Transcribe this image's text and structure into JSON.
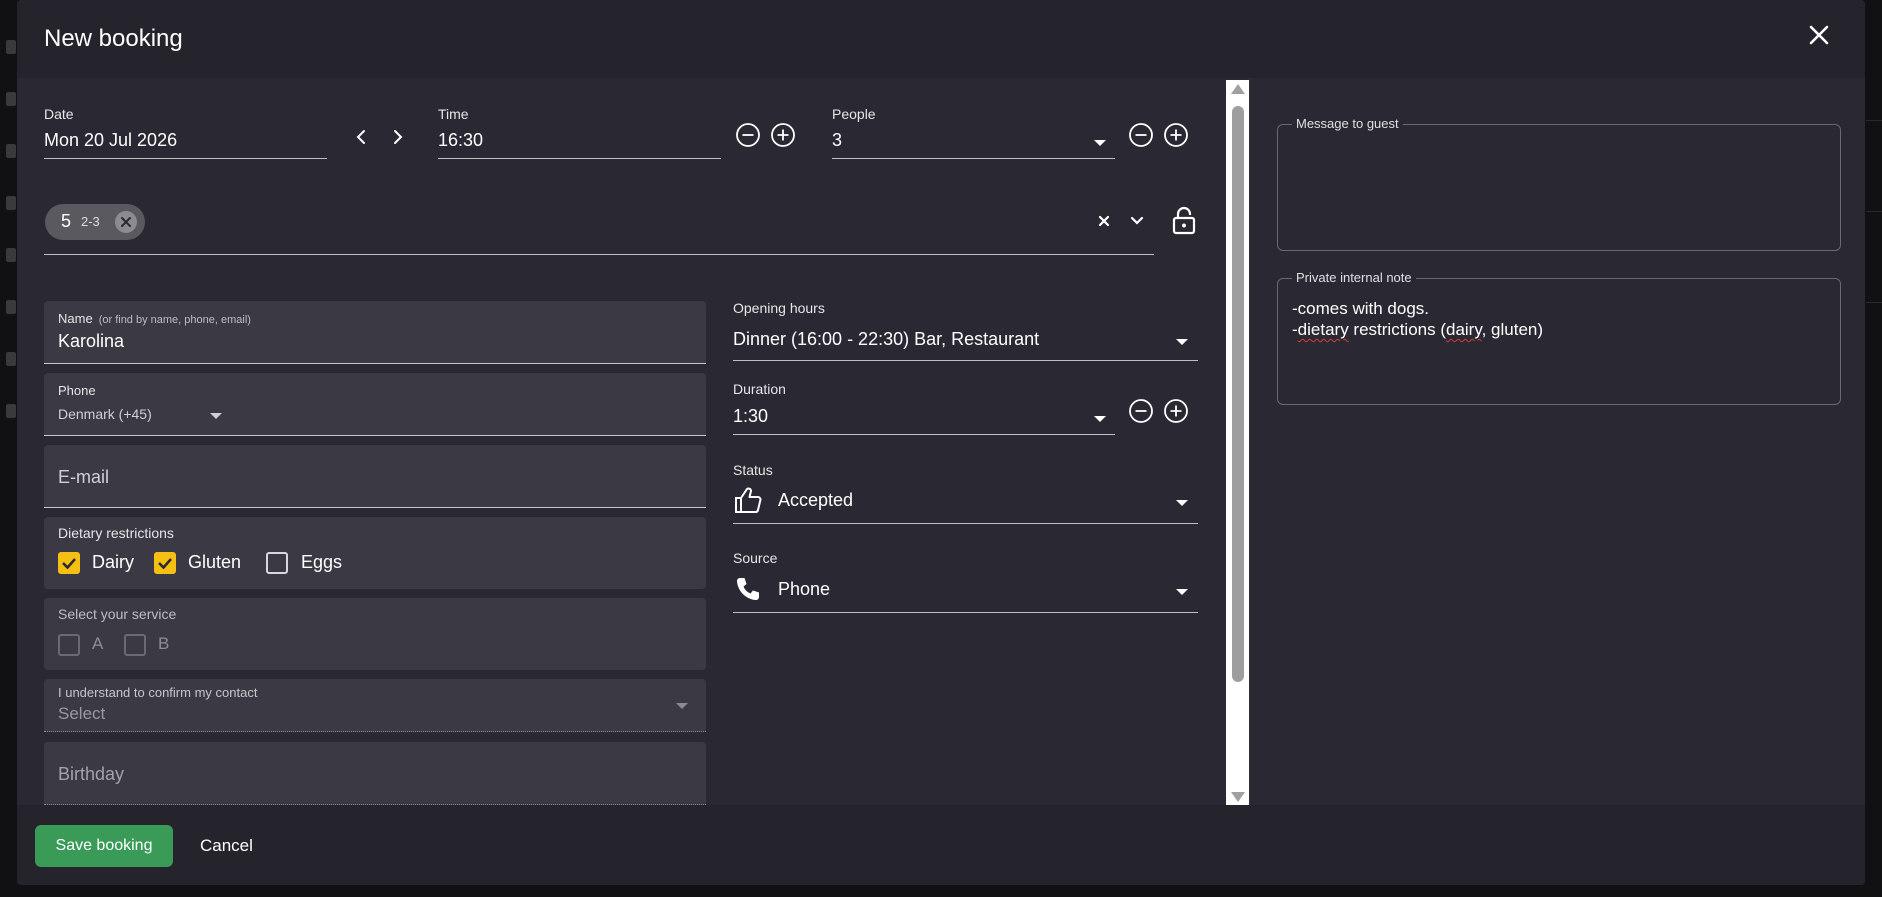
{
  "dialog": {
    "title": "New booking"
  },
  "date": {
    "label": "Date",
    "value": "Mon 20 Jul 2026"
  },
  "time": {
    "label": "Time",
    "value": "16:30"
  },
  "people": {
    "label": "People",
    "value": "3"
  },
  "table_chip": {
    "number": "5",
    "range": "2-3"
  },
  "name_field": {
    "label": "Name",
    "hint": "(or find by name, phone, email)",
    "value": "Karolina"
  },
  "phone_field": {
    "label": "Phone",
    "country": "Denmark (+45)"
  },
  "email_field": {
    "placeholder": "E-mail"
  },
  "dietary": {
    "label": "Dietary restrictions",
    "options": [
      {
        "label": "Dairy",
        "checked": true
      },
      {
        "label": "Gluten",
        "checked": true
      },
      {
        "label": "Eggs",
        "checked": false
      }
    ]
  },
  "service": {
    "label": "Select your service",
    "options": [
      {
        "label": "A"
      },
      {
        "label": "B"
      }
    ]
  },
  "confirm_contact": {
    "label": "I understand to confirm my contact",
    "placeholder": "Select"
  },
  "birthday": {
    "placeholder": "Birthday"
  },
  "opening_hours": {
    "label": "Opening hours",
    "value": "Dinner (16:00 - 22:30) Bar, Restaurant"
  },
  "duration": {
    "label": "Duration",
    "value": "1:30"
  },
  "status": {
    "label": "Status",
    "value": "Accepted"
  },
  "source": {
    "label": "Source",
    "value": "Phone"
  },
  "message_to_guest": {
    "label": "Message to guest",
    "value": ""
  },
  "private_note": {
    "label": "Private internal note",
    "line1": "-comes with dogs.",
    "line2_prefix": "-",
    "line2_word1": "dietary",
    "line2_mid": " restrictions (",
    "line2_word2": "dairy",
    "line2_suffix": ", gluten)"
  },
  "footer": {
    "save_label": "Save booking",
    "cancel_label": "Cancel"
  },
  "colors": {
    "accent": "#f5c013",
    "save": "#3a9a58",
    "dialog_bg": "#2a2832"
  }
}
